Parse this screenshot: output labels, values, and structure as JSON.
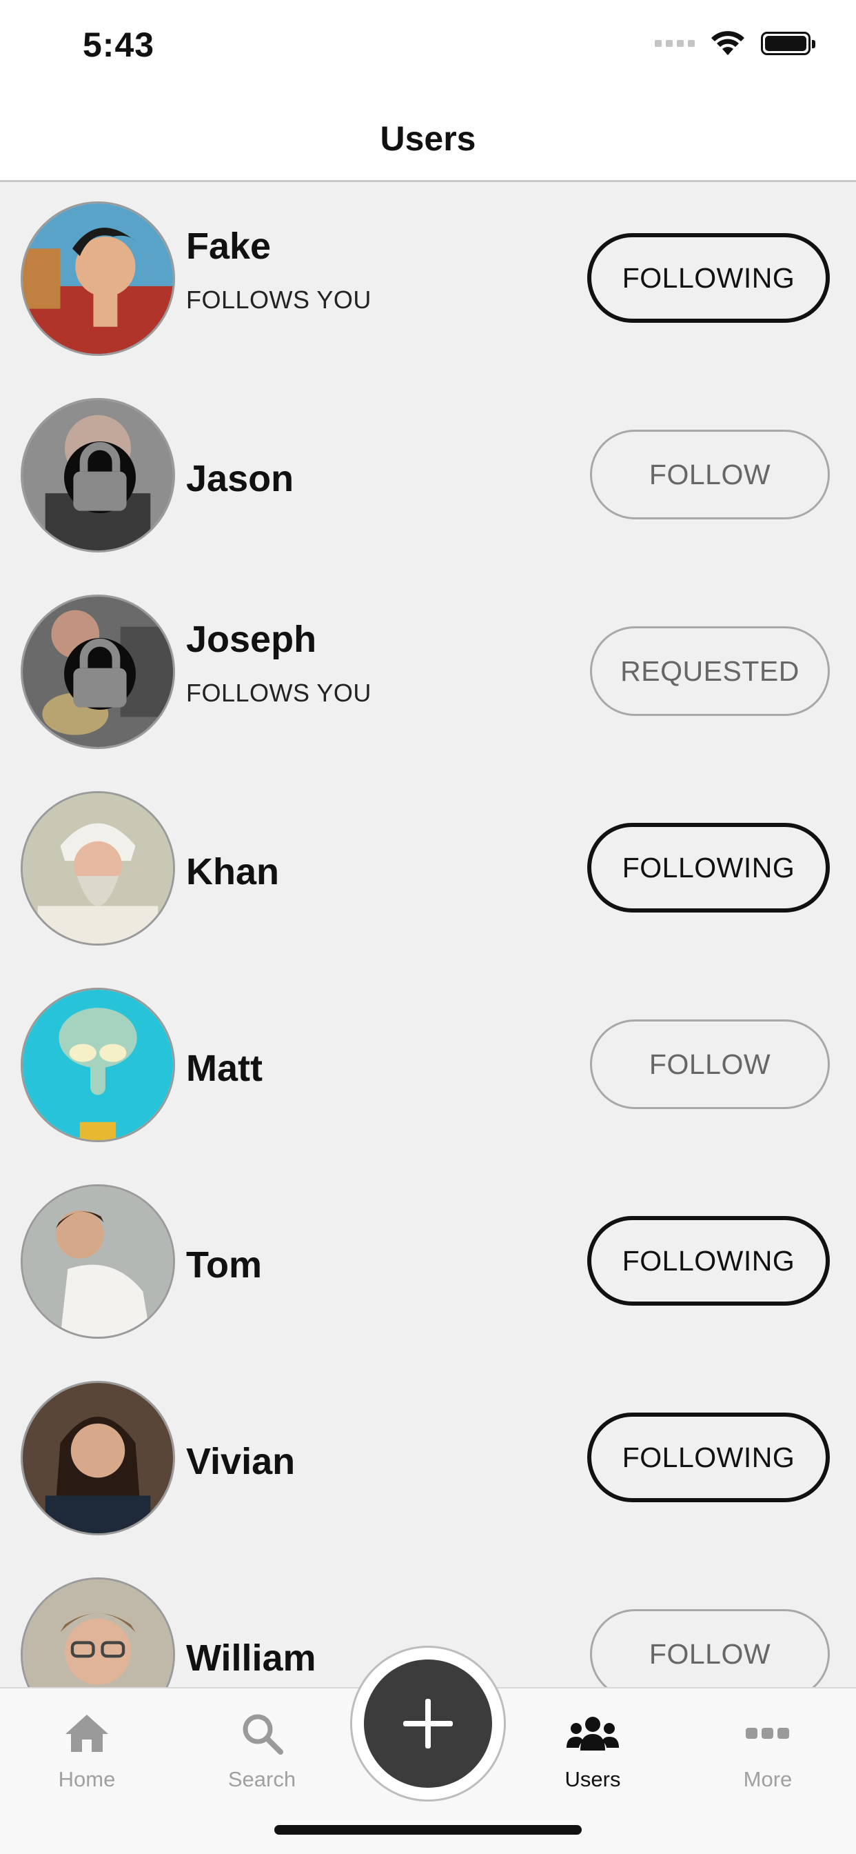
{
  "status_bar": {
    "time": "5:43"
  },
  "header": {
    "title": "Users"
  },
  "users": [
    {
      "name": "Fake",
      "subtitle": "FOLLOWS YOU",
      "button": "FOLLOWING",
      "button_state": "active",
      "locked": false
    },
    {
      "name": "Jason",
      "subtitle": "",
      "button": "FOLLOW",
      "button_state": "inactive",
      "locked": true
    },
    {
      "name": "Joseph",
      "subtitle": "FOLLOWS YOU",
      "button": "REQUESTED",
      "button_state": "inactive",
      "locked": true
    },
    {
      "name": "Khan",
      "subtitle": "",
      "button": "FOLLOWING",
      "button_state": "active",
      "locked": false
    },
    {
      "name": "Matt",
      "subtitle": "",
      "button": "FOLLOW",
      "button_state": "inactive",
      "locked": false
    },
    {
      "name": "Tom",
      "subtitle": "",
      "button": "FOLLOWING",
      "button_state": "active",
      "locked": false
    },
    {
      "name": "Vivian",
      "subtitle": "",
      "button": "FOLLOWING",
      "button_state": "active",
      "locked": false
    },
    {
      "name": "William",
      "subtitle": "",
      "button": "FOLLOW",
      "button_state": "inactive",
      "locked": false
    }
  ],
  "tab_bar": {
    "tabs": [
      {
        "label": "Home",
        "icon": "home-icon",
        "active": false
      },
      {
        "label": "Search",
        "icon": "search-icon",
        "active": false
      },
      {
        "label": "Users",
        "icon": "users-icon",
        "active": true
      },
      {
        "label": "More",
        "icon": "more-icon",
        "active": false
      }
    ],
    "fab_icon": "plus-icon"
  },
  "colors": {
    "background": "#f0f0f0",
    "header_bg": "#ffffff",
    "fab": "#3c3c3c",
    "active_text": "#111111",
    "inactive_text": "#a0a0a0"
  }
}
